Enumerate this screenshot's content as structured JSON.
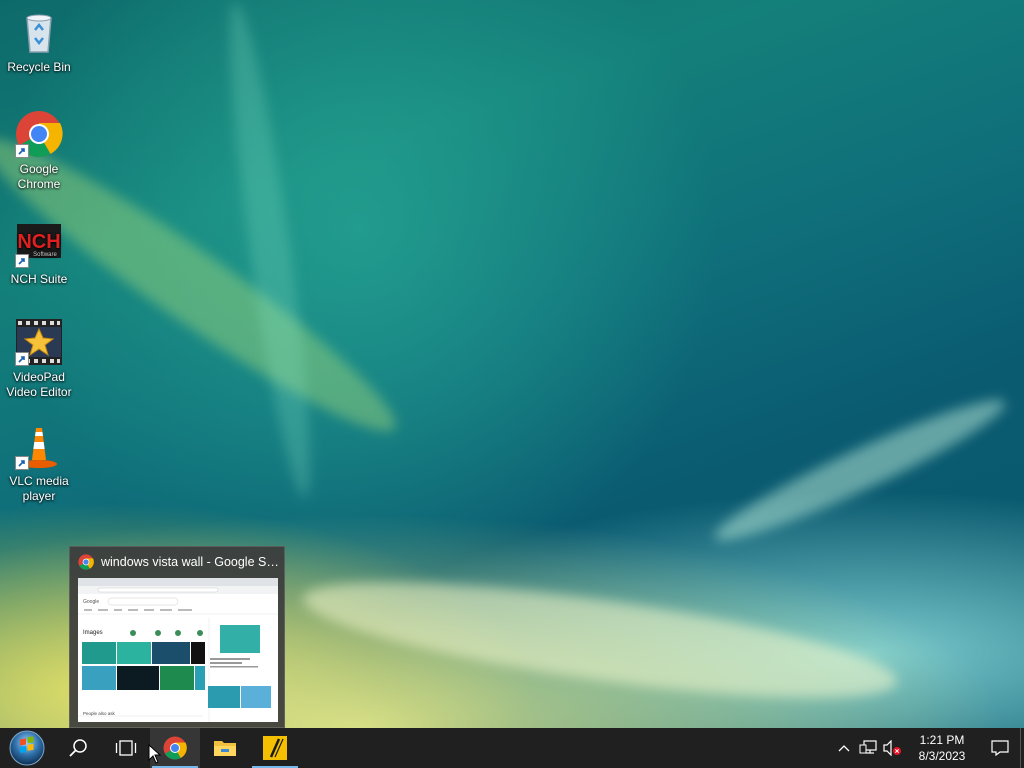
{
  "desktop": {
    "icons": [
      {
        "label": "Recycle Bin"
      },
      {
        "label": "Google Chrome"
      },
      {
        "label": "NCH Suite"
      },
      {
        "label": "VideoPad Video Editor"
      },
      {
        "label": "VLC media player"
      }
    ]
  },
  "preview": {
    "title": "windows vista wall - Google Se...",
    "thumb": {
      "brand": "Google",
      "images_heading": "Images",
      "related": "People also ask"
    }
  },
  "taskbar": {
    "icons": [
      "start-icon",
      "search-icon",
      "task-view-icon",
      "chrome-icon",
      "file-explorer-icon",
      "nch-icon"
    ],
    "clock": {
      "time": "1:21 PM",
      "date": "8/3/2023"
    },
    "tray_icons": [
      "chevron-up-icon",
      "network-icon",
      "volume-muted-icon",
      "notification-icon"
    ]
  },
  "colors": {
    "taskbar": "#202020",
    "accent": "#76b9ed"
  }
}
